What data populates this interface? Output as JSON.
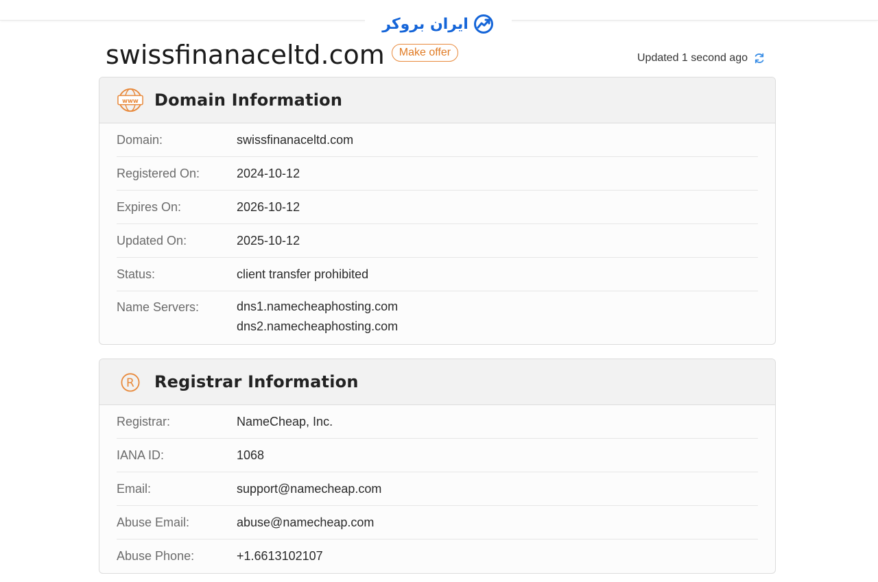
{
  "page": {
    "domain_title": "swissfinanaceltd.com",
    "offer_label": "Make offer",
    "updated_text": "Updated 1 second ago"
  },
  "logo": {
    "text": "ایران بروکر"
  },
  "domain_info": {
    "title": "Domain Information",
    "rows": [
      {
        "label": "Domain:",
        "value": "swissfinanaceltd.com"
      },
      {
        "label": "Registered On:",
        "value": "2024-10-12"
      },
      {
        "label": "Expires On:",
        "value": "2026-10-12"
      },
      {
        "label": "Updated On:",
        "value": "2025-10-12"
      },
      {
        "label": "Status:",
        "value": "client transfer prohibited"
      },
      {
        "label": "Name Servers:",
        "values": [
          "dns1.namecheaphosting.com",
          "dns2.namecheaphosting.com"
        ]
      }
    ]
  },
  "registrar_info": {
    "title": "Registrar Information",
    "rows": [
      {
        "label": "Registrar:",
        "value": "NameCheap, Inc."
      },
      {
        "label": "IANA ID:",
        "value": "1068"
      },
      {
        "label": "Email:",
        "value": "support@namecheap.com"
      },
      {
        "label": "Abuse Email:",
        "value": "abuse@namecheap.com"
      },
      {
        "label": "Abuse Phone:",
        "value": "+1.6613102107"
      }
    ]
  },
  "colors": {
    "accent_orange": "#e8893b",
    "logo_blue": "#1565d8",
    "refresh_blue": "#3a8ee6"
  },
  "icons": {
    "www": "www-icon",
    "registered": "registered-icon",
    "refresh": "refresh-icon",
    "logo": "chart-trend-icon"
  }
}
